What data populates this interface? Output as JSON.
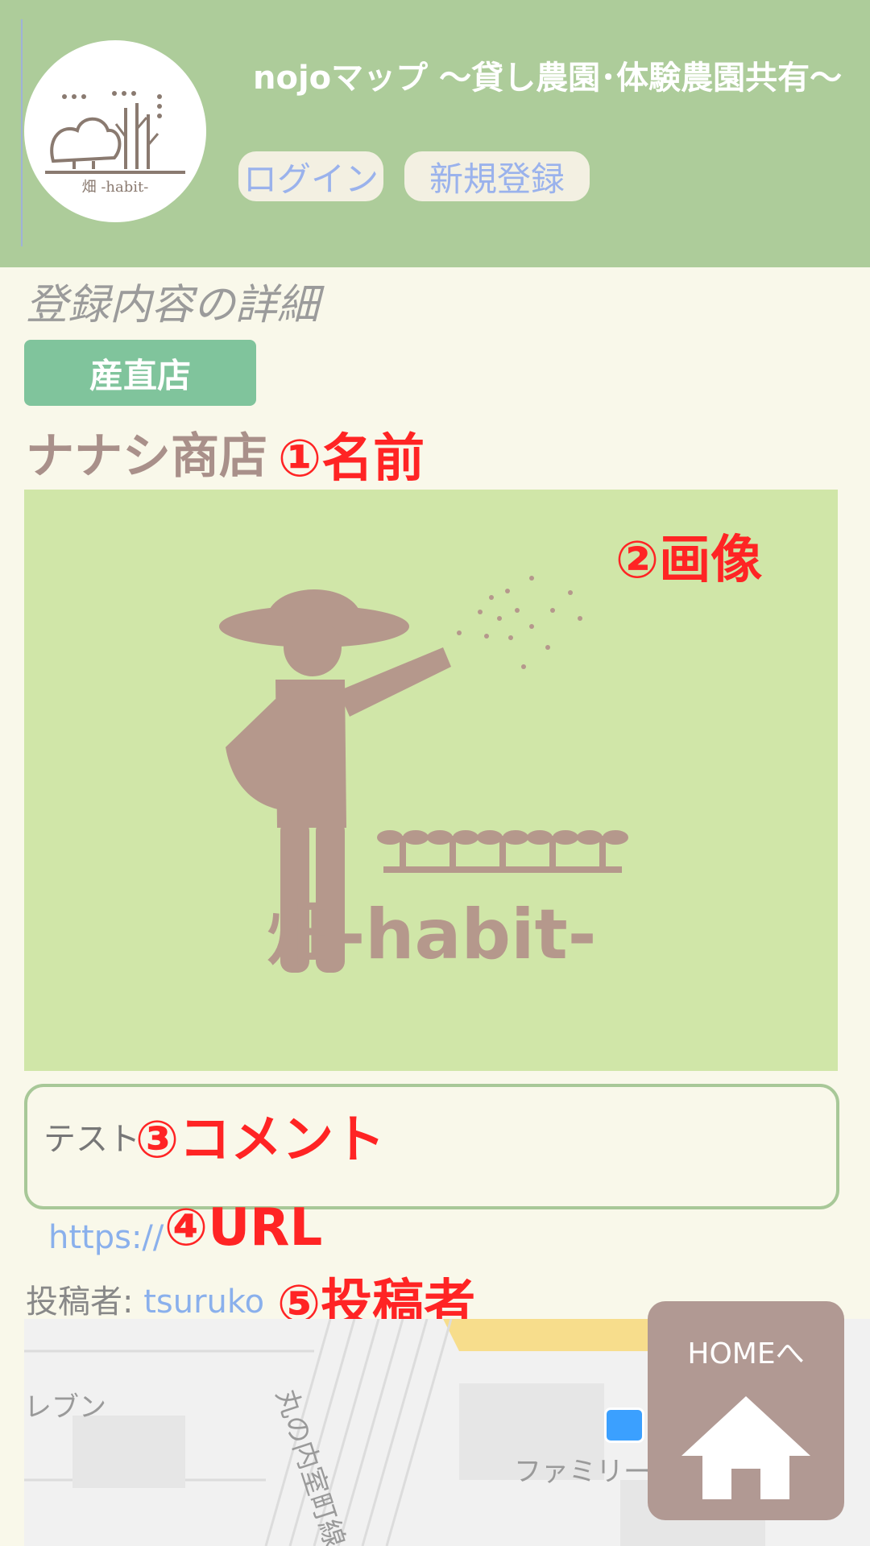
{
  "header": {
    "site_title": "nojoマップ ～貸し農園･体験農園共有～",
    "logo_text": "畑 -habit-",
    "login_label": "ログイン",
    "signup_label": "新規登録"
  },
  "detail": {
    "section_title": "登録内容の詳細",
    "category": "産直店",
    "name": "ナナシ商店",
    "image_caption": "畑-habit-",
    "comment": "テスト",
    "url": "https://",
    "poster_label": "投稿者: ",
    "poster_name": "tsuruko"
  },
  "annotations": {
    "name": "①名前",
    "image": "②画像",
    "comment": "③コメント",
    "url": "④URL",
    "poster": "⑤投稿者"
  },
  "map": {
    "label_left": "レブン",
    "label_store": "ファミリー",
    "label_street": "丸の内室町線"
  },
  "home_button": {
    "label": "HOMEへ"
  },
  "colors": {
    "header_bg": "#adcc9a",
    "page_bg": "#f9f8ea",
    "category_bg": "#80c49c",
    "image_bg": "#d0e6a8",
    "figure": "#b5988c",
    "annotation": "#ff2424",
    "link": "#8ab0ec",
    "home_bg": "#b19993"
  },
  "icons": [
    "logo-icon",
    "farmer-illustration",
    "home-icon",
    "shop-basket-icon"
  ]
}
